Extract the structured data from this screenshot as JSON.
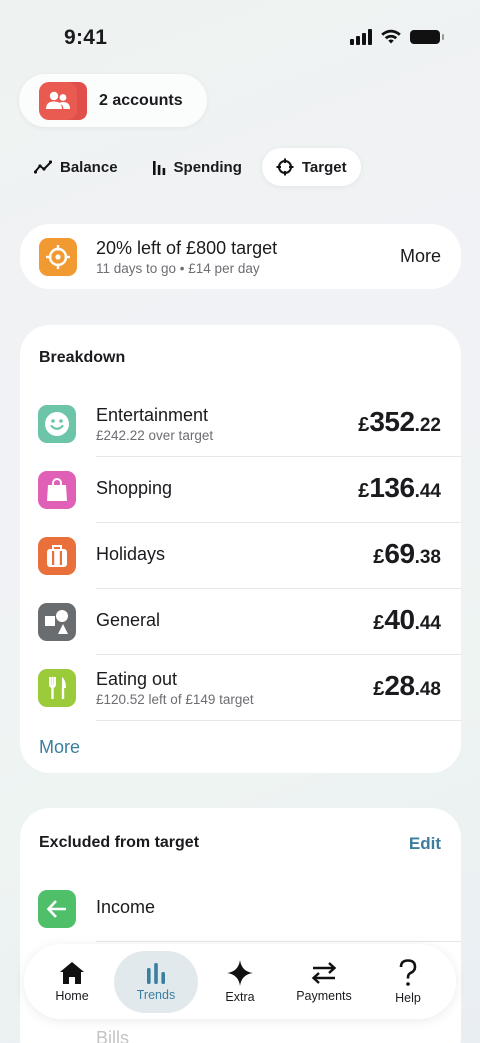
{
  "status_bar": {
    "time": "9:41"
  },
  "accounts": {
    "label": "2 accounts"
  },
  "tabs": [
    {
      "label": "Balance",
      "icon": "trend-line-icon"
    },
    {
      "label": "Spending",
      "icon": "bar-chart-icon"
    },
    {
      "label": "Target",
      "icon": "crosshair-icon",
      "active": true
    }
  ],
  "target": {
    "title": "20% left of £800 target",
    "subtitle": "11 days to go • £14 per day",
    "more_label": "More",
    "icon_color": "#F29A32"
  },
  "breakdown": {
    "heading": "Breakdown",
    "rows": [
      {
        "name": "Entertainment",
        "sub": "£242.22 over target",
        "currency": "£",
        "major": "352",
        "minor": ".22",
        "icon": "smiley-icon",
        "color": "#6CC5A9"
      },
      {
        "name": "Shopping",
        "sub": "",
        "currency": "£",
        "major": "136",
        "minor": ".44",
        "icon": "shopping-bag-icon",
        "color": "#E060B8"
      },
      {
        "name": "Holidays",
        "sub": "",
        "currency": "£",
        "major": "69",
        "minor": ".38",
        "icon": "suitcase-icon",
        "color": "#E9703A"
      },
      {
        "name": "General",
        "sub": "",
        "currency": "£",
        "major": "40",
        "minor": ".44",
        "icon": "shapes-icon",
        "color": "#6A6D70"
      },
      {
        "name": "Eating out",
        "sub": "£120.52 left of £149 target",
        "currency": "£",
        "major": "28",
        "minor": ".48",
        "icon": "cutlery-icon",
        "color": "#9BCB3B"
      }
    ],
    "more_label": "More"
  },
  "excluded": {
    "heading": "Excluded from target",
    "edit_label": "Edit",
    "rows": [
      {
        "name": "Income",
        "icon": "arrow-left-icon",
        "color": "#4FBF6A"
      }
    ],
    "obscured_labels": [
      "Bills"
    ]
  },
  "bottom_nav": [
    {
      "label": "Home",
      "icon": "home-icon"
    },
    {
      "label": "Trends",
      "icon": "trends-icon",
      "active": true
    },
    {
      "label": "Extra",
      "icon": "sparkle-icon"
    },
    {
      "label": "Payments",
      "icon": "swap-arrows-icon"
    },
    {
      "label": "Help",
      "icon": "question-icon"
    }
  ],
  "colors": {
    "accent": "#3A7F9E",
    "card": "#FFFFFF"
  }
}
